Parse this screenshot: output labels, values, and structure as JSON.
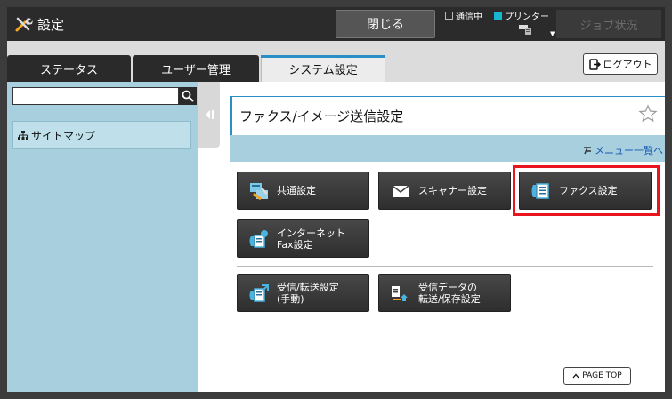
{
  "header": {
    "title": "設定",
    "close_label": "閉じる",
    "status_comm": "通信中",
    "status_printer": "プリンター",
    "job_status_label": "ジョブ状況"
  },
  "tabs": [
    {
      "label": "ステータス",
      "active": false
    },
    {
      "label": "ユーザー管理",
      "active": false
    },
    {
      "label": "システム設定",
      "active": true
    }
  ],
  "logout_label": "ログアウト",
  "sidebar": {
    "search_value": "",
    "sitemap_label": "サイトマップ"
  },
  "main": {
    "title": "ファクス/イメージ送信設定",
    "menu_link": "メニュー一覧へ",
    "tiles": {
      "common": "共通設定",
      "scanner": "スキャナー設定",
      "fax": "ファクス設定",
      "internet_fax": "インターネット\nFax設定",
      "recv_forward": "受信/転送設定\n(手動)",
      "recv_data": "受信データの\n転送/保存設定"
    },
    "highlighted_tile": "fax",
    "page_top_label": "PAGE TOP"
  },
  "colors": {
    "accent_blue": "#2a8ec6",
    "panel_blue": "#a8cfdd",
    "highlight_red": "#e8141e",
    "printer_cyan": "#17b6d1"
  },
  "icons": [
    "wrench-icon",
    "printer-icon",
    "logout-icon",
    "search-icon",
    "sitemap-icon",
    "collapse-icon",
    "star-icon",
    "menu-list-icon",
    "common-settings-icon",
    "scanner-envelope-icon",
    "fax-icon",
    "internet-fax-icon",
    "receive-forward-icon",
    "receive-data-icon",
    "chevron-up-icon"
  ]
}
